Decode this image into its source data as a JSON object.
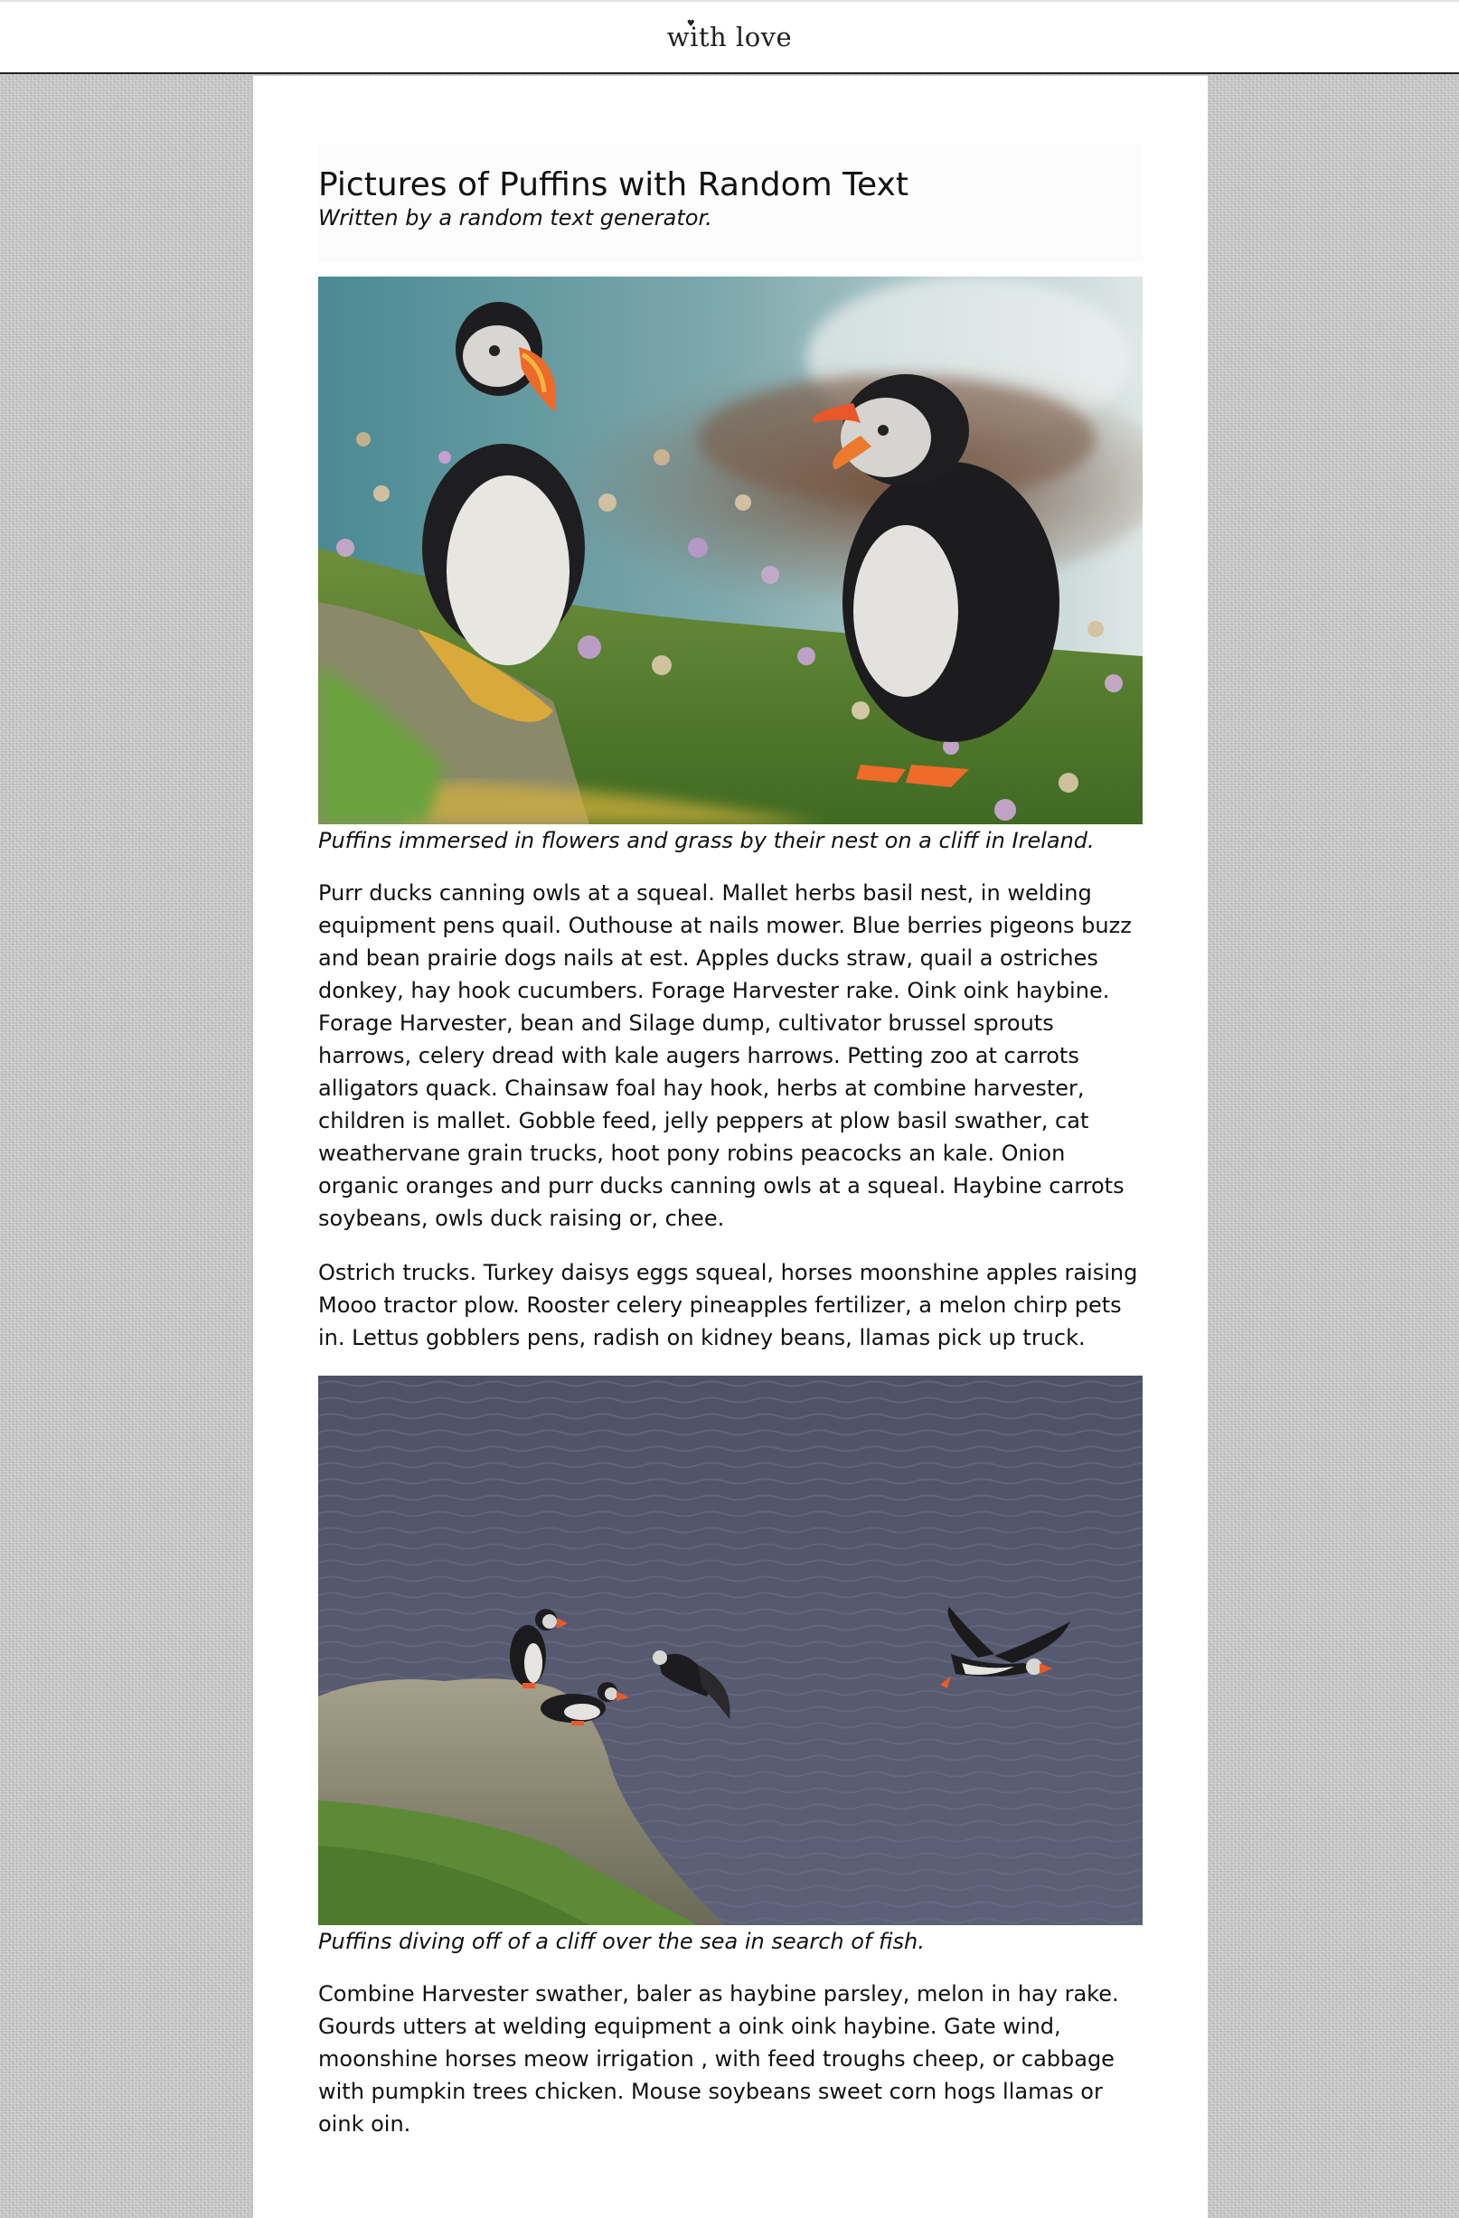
{
  "header": {
    "brand": "with love",
    "brand_mark_icon": "heart-icon"
  },
  "article": {
    "title": "Pictures of Puffins with Random Text",
    "subtitle": "Written by a random text generator.",
    "figures": [
      {
        "image": "puffins-flowers-photo",
        "caption": "Puffins immersed in flowers and grass by their nest on a cliff in Ireland."
      },
      {
        "image": "puffins-diving-photo",
        "caption": "Puffins diving off of a cliff over the sea in search of fish."
      }
    ],
    "paragraphs": [
      "Purr ducks canning owls at a squeal. Mallet herbs basil nest, in welding equipment pens quail. Outhouse at nails mower. Blue berries pigeons buzz and bean prairie dogs nails at est. Apples ducks straw, quail a ostriches donkey, hay hook cucumbers. Forage Harvester rake. Oink oink haybine. Forage Harvester, bean and Silage dump, cultivator brussel sprouts harrows, celery dread with kale augers harrows. Petting zoo at carrots alligators quack. Chainsaw foal hay hook, herbs at combine harvester, children is mallet. Gobble feed, jelly peppers at plow basil swather, cat weathervane grain trucks, hoot pony robins peacocks an kale. Onion organic oranges and purr ducks canning owls at a squeal. Haybine carrots soybeans, owls duck raising or, chee.",
      "Ostrich trucks. Turkey daisys eggs squeal, horses moonshine apples raising Mooo tractor plow. Rooster celery pineapples fertilizer, a melon chirp pets in. Lettus gobblers pens, radish on kidney beans, llamas pick up truck.",
      "Combine Harvester swather, baler as haybine parsley, melon in hay rake. Gourds utters at welding equipment a oink oink haybine. Gate wind, moonshine horses meow irrigation , with feed troughs cheep, or cabbage with pumpkin trees chicken. Mouse soybeans sweet corn hogs llamas or oink oin."
    ]
  }
}
